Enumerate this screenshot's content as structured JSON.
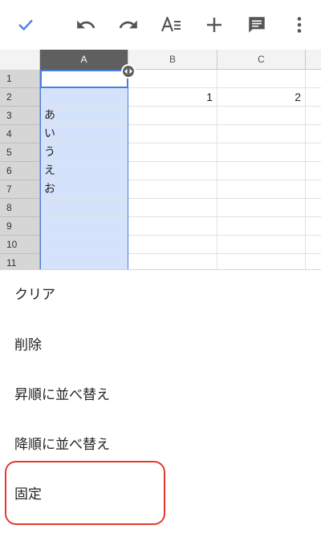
{
  "toolbar": {
    "icons": [
      "check-icon",
      "undo-icon",
      "redo-icon",
      "text-format-icon",
      "add-icon",
      "comment-icon",
      "more-vert-icon"
    ],
    "accent_color": "#4a7de2"
  },
  "sheet": {
    "columns": [
      "A",
      "B",
      "C"
    ],
    "selected_column": "A",
    "rows": [
      {
        "num": "1",
        "a": "",
        "b": "",
        "c": ""
      },
      {
        "num": "2",
        "a": "",
        "b": "1",
        "c": "2"
      },
      {
        "num": "3",
        "a": "あ",
        "b": "",
        "c": ""
      },
      {
        "num": "4",
        "a": "い",
        "b": "",
        "c": ""
      },
      {
        "num": "5",
        "a": "う",
        "b": "",
        "c": ""
      },
      {
        "num": "6",
        "a": "え",
        "b": "",
        "c": ""
      },
      {
        "num": "7",
        "a": "お",
        "b": "",
        "c": ""
      },
      {
        "num": "8",
        "a": "",
        "b": "",
        "c": ""
      },
      {
        "num": "9",
        "a": "",
        "b": "",
        "c": ""
      },
      {
        "num": "10",
        "a": "",
        "b": "",
        "c": ""
      },
      {
        "num": "11",
        "a": "",
        "b": "",
        "c": ""
      }
    ]
  },
  "menu": {
    "items": [
      "クリア",
      "削除",
      "昇順に並べ替え",
      "降順に並べ替え",
      "固定"
    ],
    "highlighted_item": "固定",
    "highlight_color": "#e23a2f"
  }
}
